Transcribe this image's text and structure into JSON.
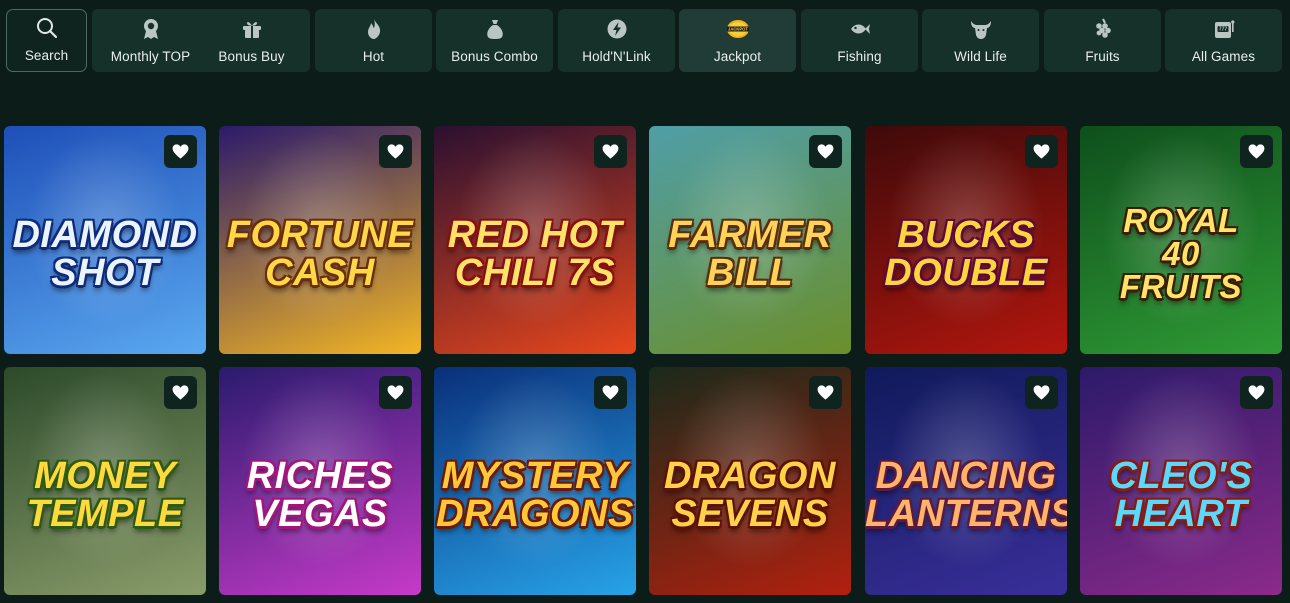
{
  "categories": [
    {
      "label": "Search",
      "icon": "search-icon",
      "active": false
    },
    {
      "label": "Monthly TOP",
      "icon": "medal-icon",
      "active": false
    },
    {
      "label": "Bonus Buy",
      "icon": "gift-icon",
      "active": false
    },
    {
      "label": "Hot",
      "icon": "flame-icon",
      "active": false
    },
    {
      "label": "Bonus Combo",
      "icon": "money-bag-icon",
      "active": false
    },
    {
      "label": "Hold'N'Link",
      "icon": "lightning-icon",
      "active": false
    },
    {
      "label": "Jackpot",
      "icon": "jackpot-badge-icon",
      "jackpot_badge": "JACKPOT",
      "active": true
    },
    {
      "label": "Fishing",
      "icon": "fish-icon",
      "active": false
    },
    {
      "label": "Wild Life",
      "icon": "buffalo-icon",
      "active": false
    },
    {
      "label": "Fruits",
      "icon": "grapes-icon",
      "active": false
    },
    {
      "label": "All Games",
      "icon": "slot-machine-icon",
      "active": false
    }
  ],
  "games": [
    {
      "title_lines": [
        "Diamond",
        "Shot"
      ],
      "colors": [
        "#1e4fb8",
        "#5aa8f0"
      ],
      "text_color": "#e9f4ff",
      "stroke": "#0e2a78"
    },
    {
      "title_lines": [
        "Fortune",
        "Cash"
      ],
      "colors": [
        "#2b1a6b",
        "#f3b623"
      ],
      "text_color": "#ffd84a",
      "stroke": "#6b2e0a"
    },
    {
      "title_lines": [
        "Red Hot",
        "Chili 7s"
      ],
      "colors": [
        "#2a1030",
        "#e8471c"
      ],
      "text_color": "#ffe26a",
      "stroke": "#8a0f0f"
    },
    {
      "title_lines": [
        "Farmer",
        "Bill"
      ],
      "colors": [
        "#4f9ea8",
        "#6b8f2a"
      ],
      "text_color": "#ffd35a",
      "stroke": "#5a2d0c"
    },
    {
      "title_lines": [
        "Bucks",
        "Double"
      ],
      "colors": [
        "#3e0a0a",
        "#b3160e"
      ],
      "text_color": "#ffd53d",
      "stroke": "#5d0a3b"
    },
    {
      "title_lines": [
        "Royal",
        "40",
        "Fruits"
      ],
      "colors": [
        "#0e4f1c",
        "#2f9b35"
      ],
      "text_color": "#ffe46b",
      "stroke": "#3b1c05"
    },
    {
      "title_lines": [
        "Money",
        "Temple"
      ],
      "colors": [
        "#2c4a2a",
        "#8a9c6a"
      ],
      "text_color": "#ffd93d",
      "stroke": "#2d5a12"
    },
    {
      "title_lines": [
        "Riches",
        "Vegas"
      ],
      "colors": [
        "#2a1b6e",
        "#c63ac8"
      ],
      "text_color": "#ffffff",
      "stroke": "#a2157d"
    },
    {
      "title_lines": [
        "Mystery",
        "Dragons"
      ],
      "colors": [
        "#0a2f7a",
        "#27a3e8"
      ],
      "text_color": "#ffc83a",
      "stroke": "#6a1a05"
    },
    {
      "title_lines": [
        "Dragon",
        "Sevens"
      ],
      "colors": [
        "#1a2a1a",
        "#b3200f"
      ],
      "text_color": "#ffd24a",
      "stroke": "#5e1205"
    },
    {
      "title_lines": [
        "Dancing",
        "Lanterns"
      ],
      "colors": [
        "#101a5a",
        "#3a2f9a"
      ],
      "text_color": "#ffb46a",
      "stroke": "#5a1a40"
    },
    {
      "title_lines": [
        "Cleo's",
        "Heart"
      ],
      "colors": [
        "#2c1a6a",
        "#8b2a8a"
      ],
      "text_color": "#5ad8ff",
      "stroke": "#8a1a0a"
    }
  ]
}
